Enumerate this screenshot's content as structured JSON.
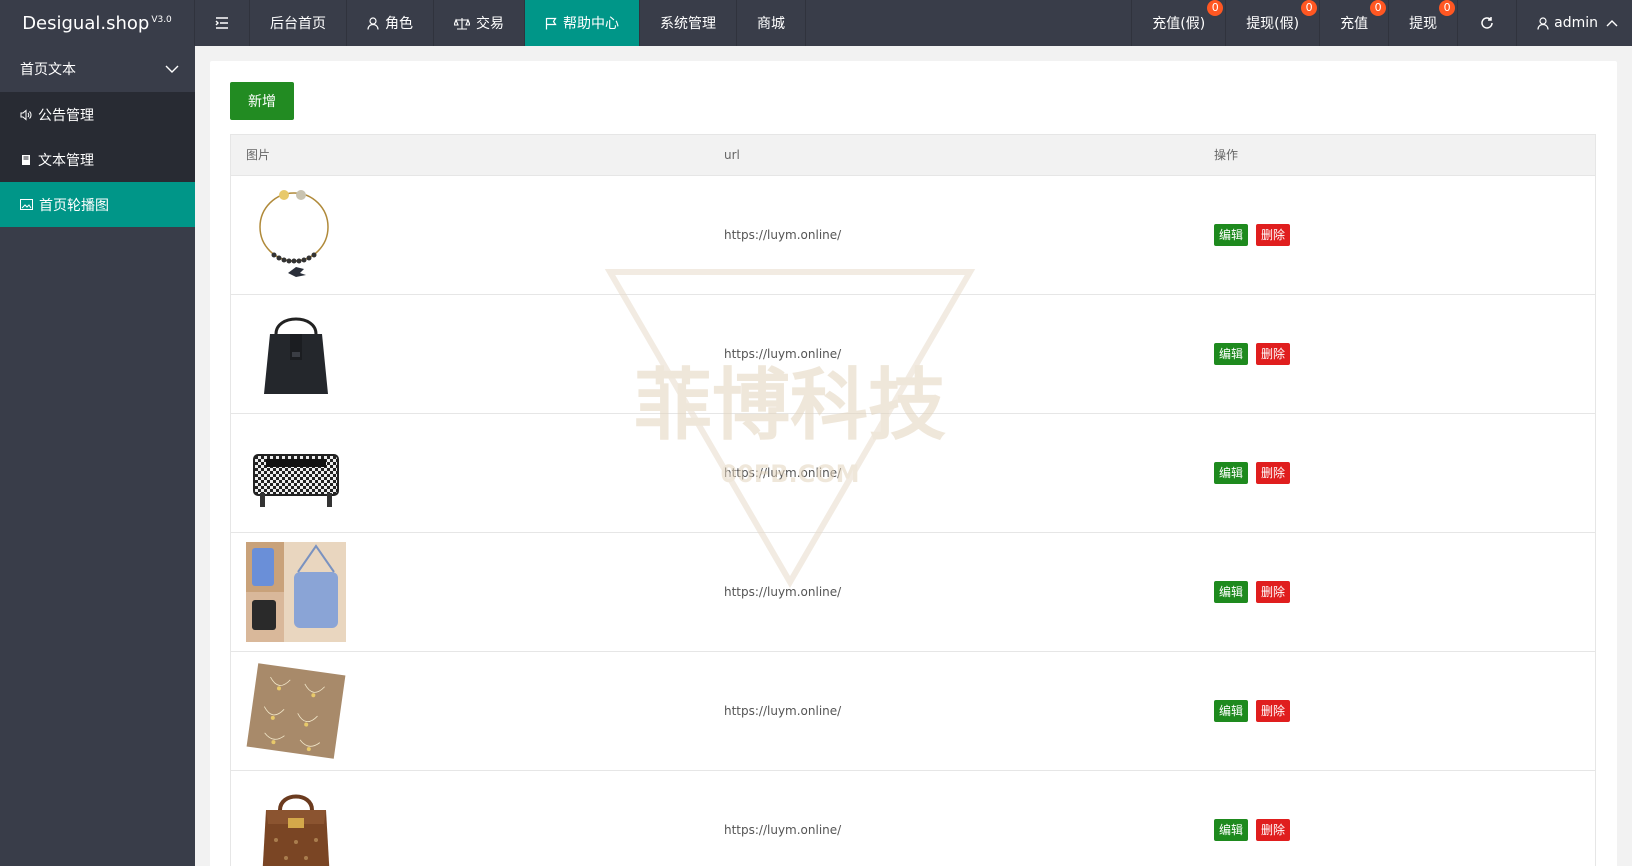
{
  "header": {
    "logo_text": "Desigual.shop",
    "logo_version": "V3.0",
    "nav": [
      {
        "label": "后台首页"
      },
      {
        "label": "角色"
      },
      {
        "label": "交易"
      },
      {
        "label": "帮助中心"
      },
      {
        "label": "系统管理"
      },
      {
        "label": "商城"
      }
    ],
    "active_nav": "帮助中心",
    "right": [
      {
        "label": "充值(假)",
        "badge": "0"
      },
      {
        "label": "提现(假)",
        "badge": "0"
      },
      {
        "label": "充值",
        "badge": "0"
      },
      {
        "label": "提现",
        "badge": "0"
      }
    ],
    "user": "admin"
  },
  "sidebar": {
    "group_label": "首页文本",
    "items": [
      {
        "label": "公告管理"
      },
      {
        "label": "文本管理"
      },
      {
        "label": "首页轮播图"
      }
    ],
    "active_item": "首页轮播图"
  },
  "main": {
    "add_button": "新增",
    "columns": [
      "图片",
      "url",
      "操作"
    ],
    "rows": [
      {
        "image": "necklace",
        "url": "https://luym.online/",
        "edit": "编辑",
        "delete": "删除"
      },
      {
        "image": "black-bucket-bag",
        "url": "https://luym.online/",
        "edit": "编辑",
        "delete": "删除"
      },
      {
        "image": "houndstooth-bag",
        "url": "https://luym.online/",
        "edit": "编辑",
        "delete": "删除"
      },
      {
        "image": "blue-phone-bag",
        "url": "https://luym.online/",
        "edit": "编辑",
        "delete": "删除"
      },
      {
        "image": "gold-jewelry-set",
        "url": "https://luym.online/",
        "edit": "编辑",
        "delete": "删除"
      },
      {
        "image": "monogram-handbag",
        "url": "https://luym.online/",
        "edit": "编辑",
        "delete": "删除"
      }
    ]
  },
  "watermark": {
    "title": "菲博科技",
    "sub": "00FB.COM"
  },
  "colors": {
    "header_bg": "#393d49",
    "active": "#009688",
    "badge": "#ff5722",
    "edit": "#1e8a1e",
    "delete": "#e01e1e"
  }
}
